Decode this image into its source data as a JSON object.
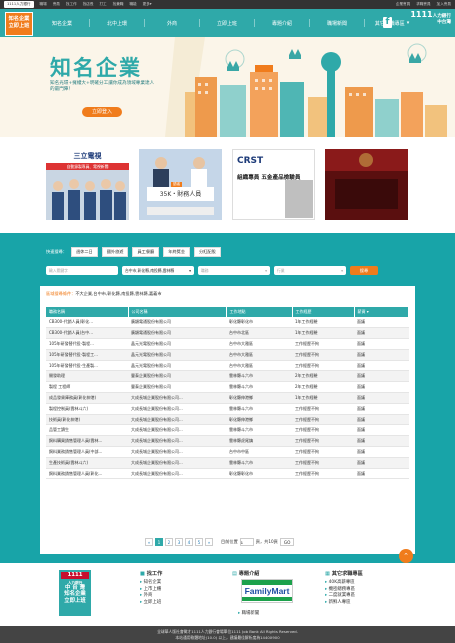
{
  "topbar": {
    "links": [
      "1111人力銀行",
      "職場",
      "會員",
      "找工作",
      "找店長",
      "打工",
      "找兼職",
      "職能",
      "更多▾"
    ],
    "right": [
      "企業會員",
      "求職會員",
      "加入會員"
    ]
  },
  "logo": {
    "line1": "知名企業",
    "line2": "立即上班"
  },
  "nav": {
    "items": [
      "知名企業",
      "北中上環",
      "外商",
      "立即上班",
      "專題介紹",
      "職場新聞",
      "其它求職專區"
    ]
  },
  "brand": {
    "num": "1111",
    "small": "人力銀行",
    "region": "中台灣"
  },
  "hero": {
    "title": "知名企業",
    "desc": "知名光環+擁權大+明確分工讓你成為領域專業達人的最門陣！",
    "cta": "立即登入"
  },
  "cards": [
    {
      "name": "三立電視",
      "sub": "自動錄製專員、電視新聞"
    },
    {
      "name": "35K・財務人員",
      "sub": "讀者"
    },
    {
      "name": "CRST",
      "sub": "組織專員 五金產品檢驗員"
    },
    {
      "name": "",
      "sub": ""
    }
  ],
  "filters": {
    "label": "快速搜尋：",
    "chips": [
      "週休二日",
      "國外旅遊",
      "員工餐廳",
      "年終獎金",
      "分紅配股"
    ]
  },
  "search": {
    "keyword": "輸入關鍵字",
    "area": "台中市,彰化縣,南投縣,雲林縣",
    "cat": "職務",
    "type": "行業",
    "btn": "搜尋"
  },
  "location": {
    "key": "區域搜尋條件：",
    "value": "不大企業,台中市,彰化縣,南投縣,雲林縣,嘉義市"
  },
  "table": {
    "headers": [
      "職務名稱",
      "公司名稱",
      "工作地點",
      "工作經歷",
      "薪資 ▾"
    ],
    "rows": [
      [
        "CB300-代銷人員(彰化...",
        "廣穎電通股份有限公司",
        "彰化縣彰化市",
        "1年工作經驗",
        "面議"
      ],
      [
        "CB300-代銷人員(台中...",
        "廣穎電通股份有限公司",
        "台中市北區",
        "1年工作經驗",
        "面議"
      ],
      [
        "105年研發替代役-製程...",
        "晶元光電股份有限公司",
        "台中市大雅區",
        "工作經歷不拘",
        "面議"
      ],
      [
        "105年研發替代役-製程工...",
        "晶元光電股份有限公司",
        "台中市大雅區",
        "工作經歷不拘",
        "面議"
      ],
      [
        "105年研發替代役-生產製...",
        "晶元光電股份有限公司",
        "台中市大雅區",
        "工作經歷不拘",
        "面議"
      ],
      [
        "開發助理",
        "豐泰企業股份有限公司",
        "雲林縣斗六市",
        "2年工作經驗",
        "面議"
      ],
      [
        "製程 工程師",
        "豐泰企業股份有限公司",
        "雲林縣斗六市",
        "2年工作經驗",
        "面議"
      ],
      [
        "成品發貨庫務員(彰化伸港)",
        "大成長城企業股份有限公司...",
        "彰化縣伸港鄉",
        "1年工作經驗",
        "面議"
      ],
      [
        "製程控制員(雲林斗六)",
        "大成長城企業股份有限公司...",
        "雲林縣斗六市",
        "工作經歷不拘",
        "面議"
      ],
      [
        "技術員(彰化伸港)",
        "大成長城企業股份有限公司...",
        "彰化縣伸港鄉",
        "工作經歷不拘",
        "面議"
      ],
      [
        "品管工讀生",
        "大成長城企業股份有限公司...",
        "雲林縣斗六市",
        "工作經歷不拘",
        "面議"
      ],
      [
        "飼料購買銷售管理人員(雲林...",
        "大成長城企業股份有限公司...",
        "雲林縣虎尾鎮",
        "工作經歷不拘",
        "面議"
      ],
      [
        "飼料業務銷售管理人員(中部...",
        "大成長城企業股份有限公司...",
        "台中市中區",
        "工作經歷不拘",
        "面議"
      ],
      [
        "生產技術員(雲林斗六)",
        "大成長城企業股份有限公司...",
        "雲林縣斗六市",
        "工作經歷不拘",
        "面議"
      ],
      [
        "飼料業務銷售管理人員(彰化...",
        "大成長城企業股份有限公司...",
        "彰化縣彰化市",
        "工作經歷不拘",
        "面議"
      ]
    ]
  },
  "pager": {
    "first": "«",
    "pages": [
      "1",
      "2",
      "3",
      "4",
      "5"
    ],
    "next": "»",
    "goto": "目前位置",
    "pageinfo": "頁，共10頁",
    "value": "1",
    "go": "GO"
  },
  "top_btn": "⌃",
  "footer": {
    "logo_num": "1111",
    "logo_small": "人力銀行",
    "logo_region": "中 台 灣",
    "logo_l1": "知名企業",
    "logo_l2": "立即上班",
    "col1": {
      "title": "找工作",
      "items": [
        "知名企業",
        "上市上櫃",
        "外商",
        "立即上班"
      ]
    },
    "col2": {
      "title": "專題介紹",
      "items": [
        "職場新聞"
      ]
    },
    "col3": {
      "title": "其它求職專區",
      "items": [
        "40K高薪專區",
        "機密總務專區",
        "二度就業專區",
        "新鮮人專區"
      ]
    },
    "familymart": "FamilyMart",
    "copy1": "全球華人版社會徵才1111人力銀行會場單位1111 Job Bank All Rights Reserved.",
    "copy2": "本站通用軟體地址(10.0) 以上，建議最佳解析度為1440X900"
  },
  "colors": {
    "teal": "#2fa9a9",
    "orange": "#f07c1c"
  }
}
